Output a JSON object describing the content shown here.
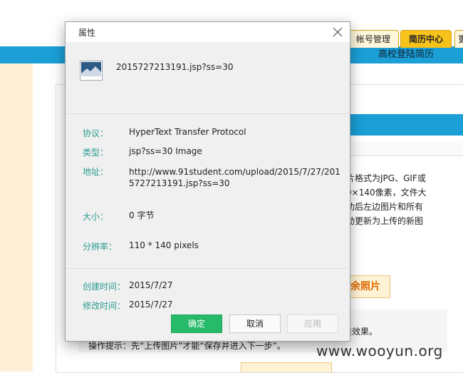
{
  "background": {
    "tabs": [
      "帐号管理",
      "简历中心",
      "更"
    ],
    "page_title": "高校登陆简历",
    "text_lines": [
      "片格式为JPG、GIF或",
      "0×140像素，文件大",
      "功后左边图片和所有",
      "动更新为上传的新图"
    ],
    "photo_button": "余照片",
    "effect_text": "佳效果。",
    "hint_text": "操作提示：先“上传图片”才能“保存并进入下一步”。",
    "watermark": "www.wooyun.org"
  },
  "dialog": {
    "title": "属性",
    "file_name": "2015727213191.jsp?ss=30",
    "properties": [
      {
        "label": "协议：",
        "value": "HyperText Transfer Protocol"
      },
      {
        "label": "类型：",
        "value": "jsp?ss=30 Image"
      },
      {
        "label": "地址：",
        "value": "http://www.91student.com/upload/2015/7/27/2015727213191.jsp?ss=30"
      },
      {
        "label": "大小：",
        "value": "0 字节"
      },
      {
        "label": "分辨率：",
        "value": "110 * 140 pixels"
      },
      {
        "label": "创建时间：",
        "value": "2015/7/27"
      },
      {
        "label": "修改时间：",
        "value": "2015/7/27"
      }
    ],
    "buttons": {
      "ok": "确定",
      "cancel": "取消",
      "apply": "应用"
    }
  }
}
